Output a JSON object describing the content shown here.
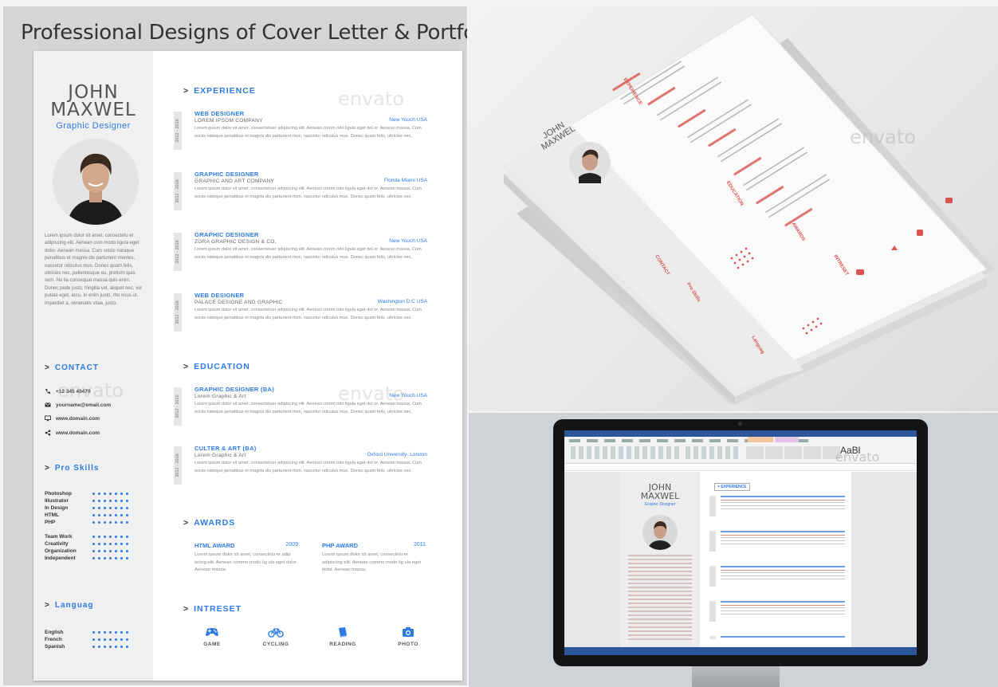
{
  "banner": {
    "title": "Professional Designs of Cover Letter & Portfolio"
  },
  "watermark": "envato",
  "resume": {
    "name_first": "JOHN",
    "name_last": "MAXWEL",
    "role": "Graphic Designer",
    "about": "Lorem ipsum dolor sit amet, consectetu er adipiscing elit. Aenean com modo ligula eget dolor. Aenean massa. Cum sociis natoque penatibus et magnis dis parturient montes, nascetur ridiculus mus. Donec quam felis, ultricies nec, pellentesque eu, pretium quis, sem. Nu lla consequat massa quis enim. Donec pede justo, fringilla vel, aliquet nec, vul putate eget, arcu. In enim justo, rho ncus ut, imperdiet a, venenatis vitae, justo.",
    "contact": {
      "heading": "CONTACT",
      "phone": "+12 345 40479",
      "email": "yourname@email.com",
      "web1": "www.domain.com",
      "web2": "www.domain.com"
    },
    "skills": {
      "heading": "Pro Skills",
      "items": [
        "Photoshop",
        "Illustrator",
        "In Design",
        "HTML",
        "PHP",
        "Team Work",
        "Creativity",
        "Organization",
        "Independent"
      ]
    },
    "language": {
      "heading": "Languag",
      "items": [
        "English",
        "French",
        "Spanish"
      ]
    },
    "experience": {
      "heading": "EXPERIENCE",
      "items": [
        {
          "years": "2012 - 2016",
          "title": "WEB DESIGNER",
          "company": "LOREM IPSOM COMPANY",
          "location": "New Youch USA",
          "desc": "Lorem ipsum dolor sit amet, consectetuer adipiscing elit. Aenean comm odo ligula eget dol or. Aenean massa. Cum sociis natoque penatibus et magnis dis parturient mon, nascetur ridiculus mus. Donec quam felis, ultricies nec,"
        },
        {
          "years": "2012 - 2016",
          "title": "GRAPHIC DESIGNER",
          "company": "GRAPHIC AND ART COMPANY",
          "location": "Florida Miami USA",
          "desc": "Lorem ipsum dolor sit amet, consectetuer adipiscing elit. Aenean comm odo ligula eget dol or. Aenean massa. Cum sociis natoque penatibus et magnis dis parturient mon, nascetur ridiculus mus. Donec quam felis, ultricies nec,"
        },
        {
          "years": "2012 - 2016",
          "title": "GRAPHIC DESIGNER",
          "company": "ZORA GRAPHIC DESIGN & CO,",
          "location": "New Youch USA",
          "desc": "Lorem ipsum dolor sit amet, consectetuer adipiscing elit. Aenean comm odo ligula eget dol or. Aenean massa. Cum sociis natoque penatibus et magnis dis parturient mon, nascetur ridiculus mus. Donec quam felis, ultricies nec,"
        },
        {
          "years": "2012 - 2016",
          "title": "WEB DESIGNER",
          "company": "PALACE DESIGNE AND GRAPHIC",
          "location": "Washington D.C USA",
          "desc": "Lorem ipsum dolor sit amet, consectetuer adipiscing elit. Aenean comm odo ligula eget dol or. Aenean massa. Cum sociis natoque penatibus et magnis dis parturient mon, nascetur ridiculus mus. Donec quam felis, ultricies nec,"
        }
      ]
    },
    "education": {
      "heading": "EDUCATION",
      "items": [
        {
          "years": "2012 - 2016",
          "title": "GRAPHIC DESIGNER (BA)",
          "company": "Lorem Graphic & Art",
          "location": "New Youch USA",
          "desc": "Lorem ipsum dolor sit amet, consectetuer adipiscing elit. Aenean comm odo ligula eget dol or. Aenean massa. Cum sociis natoque penatibus et magnis dis parturient mon, nascetur ridiculus mus. Donec quam felis, ultricies nec,"
        },
        {
          "years": "2012 - 2016",
          "title": "CULTER & ART (BA)",
          "company": "Lorem Graphic & Art",
          "location": "Oxford University- London",
          "desc": "Lorem ipsum dolor sit amet, consectetuer adipiscing elit. Aenean comm odo ligula eget dol or. Aenean massa. Cum sociis natoque penatibus et magnis dis parturient mon, nascetur ridiculus mus. Donec quam felis, ultricies nec,"
        }
      ]
    },
    "awards": {
      "heading": "AWARDS",
      "items": [
        {
          "title": "HTML AWARD",
          "year": "2009",
          "desc": "Lorem ipsum dolor sit amet, consectetu er adip iscing elit. Aenean commo modo lig ula eget dolor. Aenean massa."
        },
        {
          "title": "PHP AWARD",
          "year": "2011",
          "desc": "Lorem ipsum dolor sit amet, consectetu er adipiscing elit. Aenean commo modo lig ula eget dolor. Aenean massa."
        }
      ]
    },
    "interest": {
      "heading": "INTRESET",
      "items": [
        "GAME",
        "CYCLING",
        "READING",
        "PHOTO"
      ]
    }
  },
  "stack_preview": {
    "name_first": "JOHN",
    "name_last": "MAXWEL",
    "role": "Graphic Designer",
    "sections": [
      "EXPERIENCE",
      "CONTACT",
      "Pro Skills",
      "Languag",
      "EDUCATION",
      "AWARDS",
      "INTRESET"
    ]
  },
  "monitor_preview": {
    "name_first": "JOHN",
    "name_last": "MAXWEL",
    "role": "Graphic Designer",
    "section": "EXPERIENCE",
    "big_style": "AaBl"
  },
  "colors": {
    "accent_blue": "#2c7be5",
    "accent_red": "#d9534f",
    "sidebar_gray": "#f0f0f0"
  }
}
